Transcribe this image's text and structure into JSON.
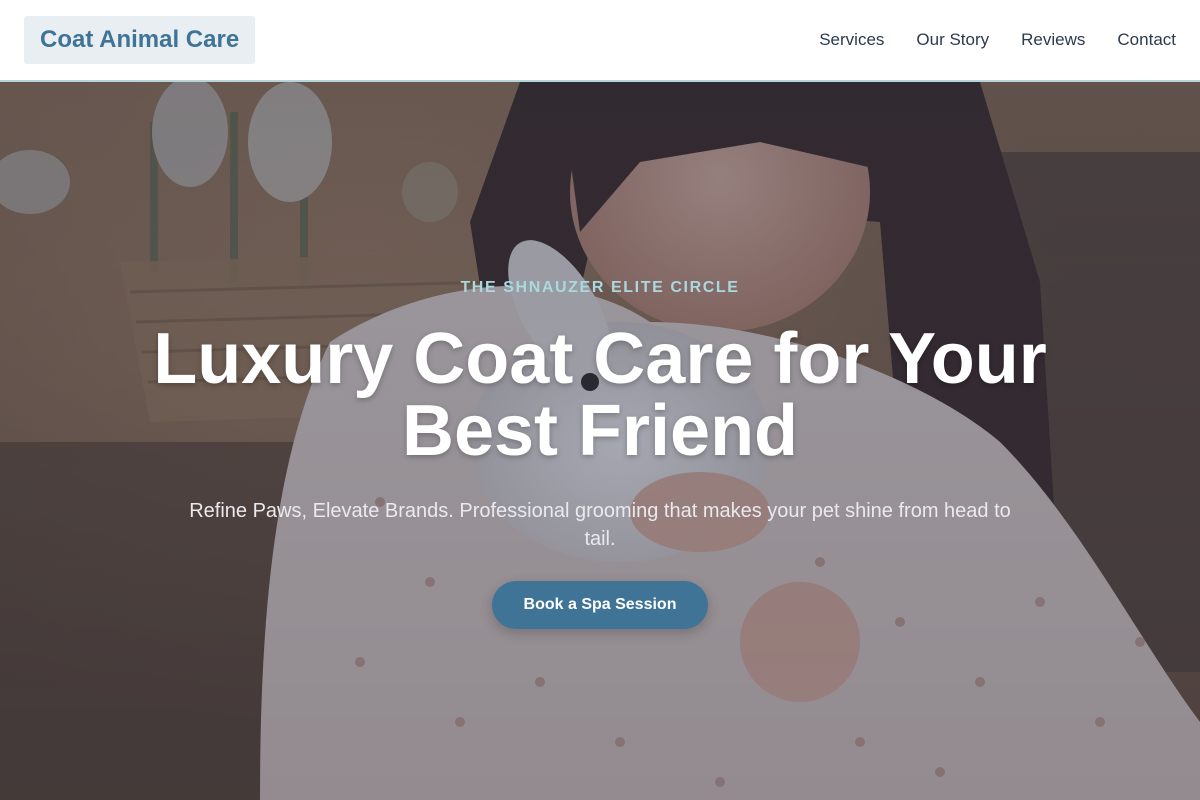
{
  "header": {
    "logo": "Coat Animal Care",
    "nav": [
      {
        "label": "Services"
      },
      {
        "label": "Our Story"
      },
      {
        "label": "Reviews"
      },
      {
        "label": "Contact"
      }
    ]
  },
  "hero": {
    "image": "woman-holding-white-rabbit-photo",
    "eyebrow": "THE SHNAUZER ELITE CIRCLE",
    "headline": "Luxury Coat Care for Your Best Friend",
    "subtext": "Refine Paws, Elevate Brands. Professional grooming that makes your pet shine from head to tail.",
    "cta_label": "Book a Spa Session"
  },
  "colors": {
    "brand": "#3f7497",
    "accent": "#a9d9df",
    "header_border": "#b7d4d9"
  }
}
